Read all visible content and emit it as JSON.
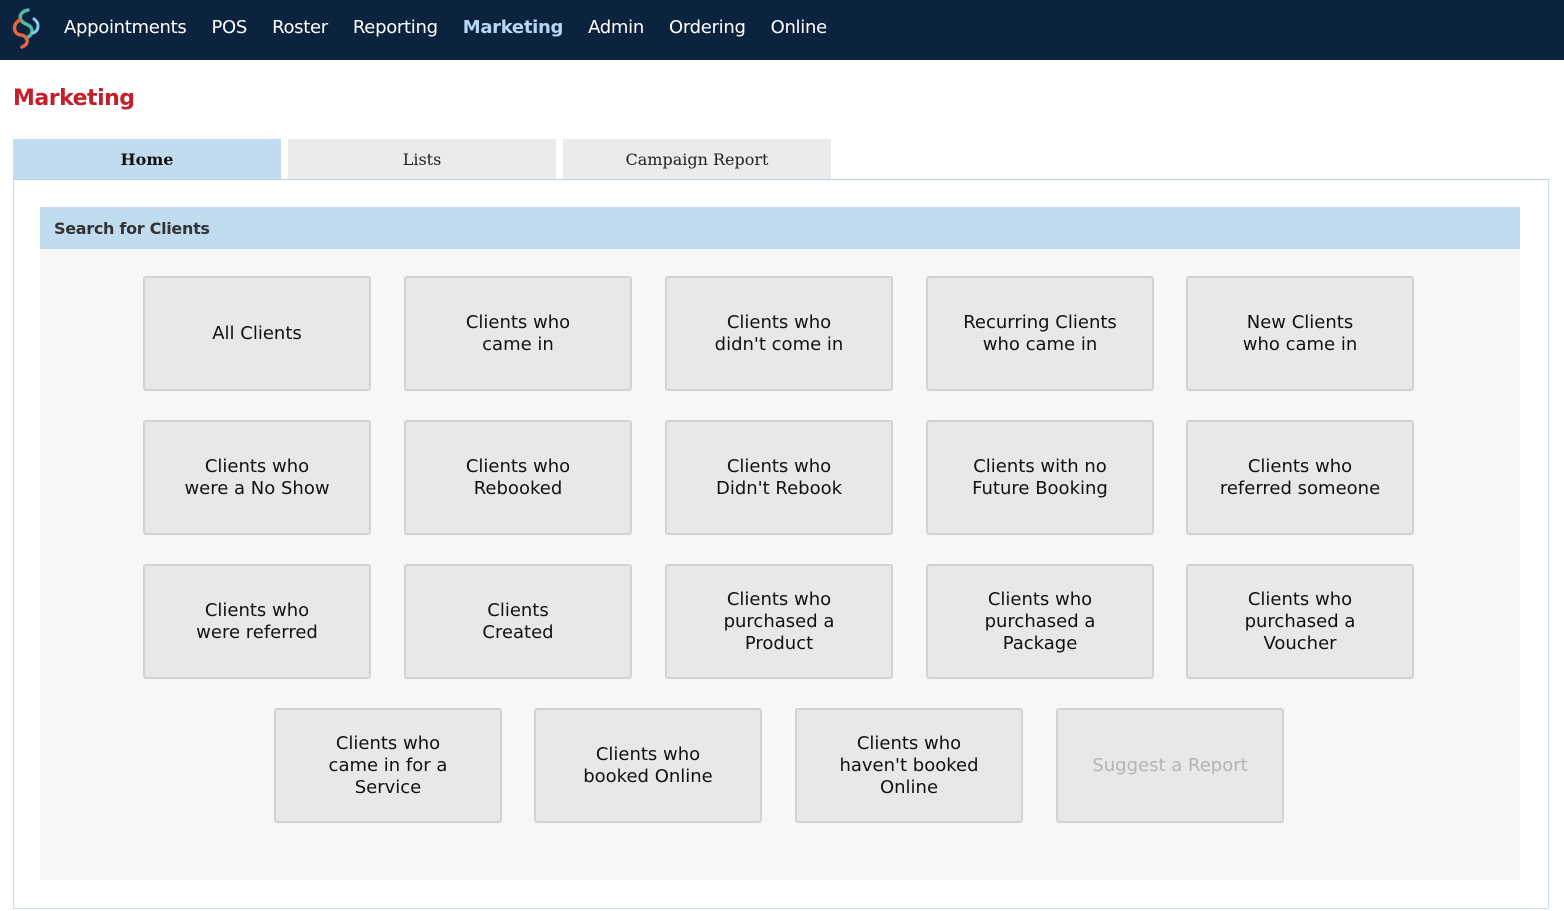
{
  "nav": {
    "items": [
      {
        "label": "Appointments",
        "active": false
      },
      {
        "label": "POS",
        "active": false
      },
      {
        "label": "Roster",
        "active": false
      },
      {
        "label": "Reporting",
        "active": false
      },
      {
        "label": "Marketing",
        "active": true
      },
      {
        "label": "Admin",
        "active": false
      },
      {
        "label": "Ordering",
        "active": false
      },
      {
        "label": "Online",
        "active": false
      }
    ]
  },
  "page": {
    "title": "Marketing"
  },
  "tabs": [
    {
      "label": "Home",
      "active": true
    },
    {
      "label": "Lists",
      "active": false
    },
    {
      "label": "Campaign Report",
      "active": false
    }
  ],
  "search_section": {
    "header": "Search for Clients",
    "tiles": [
      {
        "label": "All Clients"
      },
      {
        "label": "Clients who\ncame in"
      },
      {
        "label": "Clients who\ndidn't come in"
      },
      {
        "label": "Recurring Clients\nwho came in"
      },
      {
        "label": "New Clients\nwho came in"
      },
      {
        "label": "Clients who\nwere a No Show"
      },
      {
        "label": "Clients who\nRebooked"
      },
      {
        "label": "Clients who\nDidn't Rebook"
      },
      {
        "label": "Clients with no\nFuture Booking"
      },
      {
        "label": "Clients who\nreferred someone"
      },
      {
        "label": "Clients who\nwere referred"
      },
      {
        "label": "Clients\nCreated"
      },
      {
        "label": "Clients who\npurchased a\nProduct"
      },
      {
        "label": "Clients who\npurchased a\nPackage"
      },
      {
        "label": "Clients who\npurchased a\nVoucher"
      },
      {
        "label": "Clients who\ncame in for a\nService"
      },
      {
        "label": "Clients who\nbooked Online"
      },
      {
        "label": "Clients who\nhaven't booked\nOnline"
      },
      {
        "label": "Suggest a Report",
        "muted": true
      }
    ]
  },
  "colors": {
    "topbar": "#0c2340",
    "nav_active": "#b7d6f0",
    "title": "#c4202b",
    "tab_active": "#c2dcef",
    "tile_bg": "#e8e8e8"
  }
}
